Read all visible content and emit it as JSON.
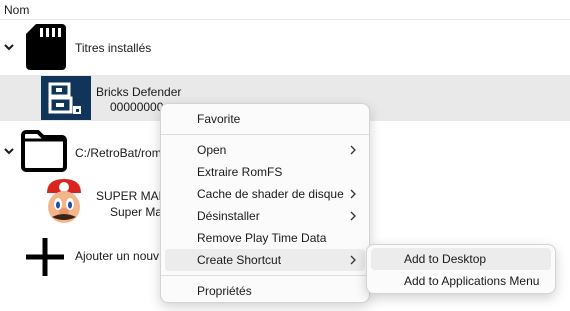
{
  "header": {
    "column_name": "Nom"
  },
  "groups": [
    {
      "label": "Titres installés",
      "icon": "sd-card-icon",
      "items": [
        {
          "title": "Bricks Defender",
          "subtitle": "00000000"
        }
      ]
    },
    {
      "label": "C:/RetroBat/rom",
      "icon": "folder-icon",
      "items": [
        {
          "title": "SUPER MAR",
          "subtitle": "Super Ma"
        }
      ]
    },
    {
      "label": "Ajouter un nouv",
      "icon": "plus-icon"
    }
  ],
  "context_menu": {
    "items": [
      {
        "label": "Favorite"
      },
      {
        "label": "Open",
        "submenu": true
      },
      {
        "label": "Extraire RomFS"
      },
      {
        "label": "Cache de shader de disque",
        "submenu": true
      },
      {
        "label": "Désinstaller",
        "submenu": true
      },
      {
        "label": "Remove Play Time Data"
      },
      {
        "label": "Create Shortcut",
        "submenu": true,
        "active": true
      },
      {
        "label": "Propriétés"
      }
    ]
  },
  "shortcut_submenu": {
    "items": [
      {
        "label": "Add to Desktop",
        "active": true
      },
      {
        "label": "Add to Applications Menu"
      }
    ]
  }
}
